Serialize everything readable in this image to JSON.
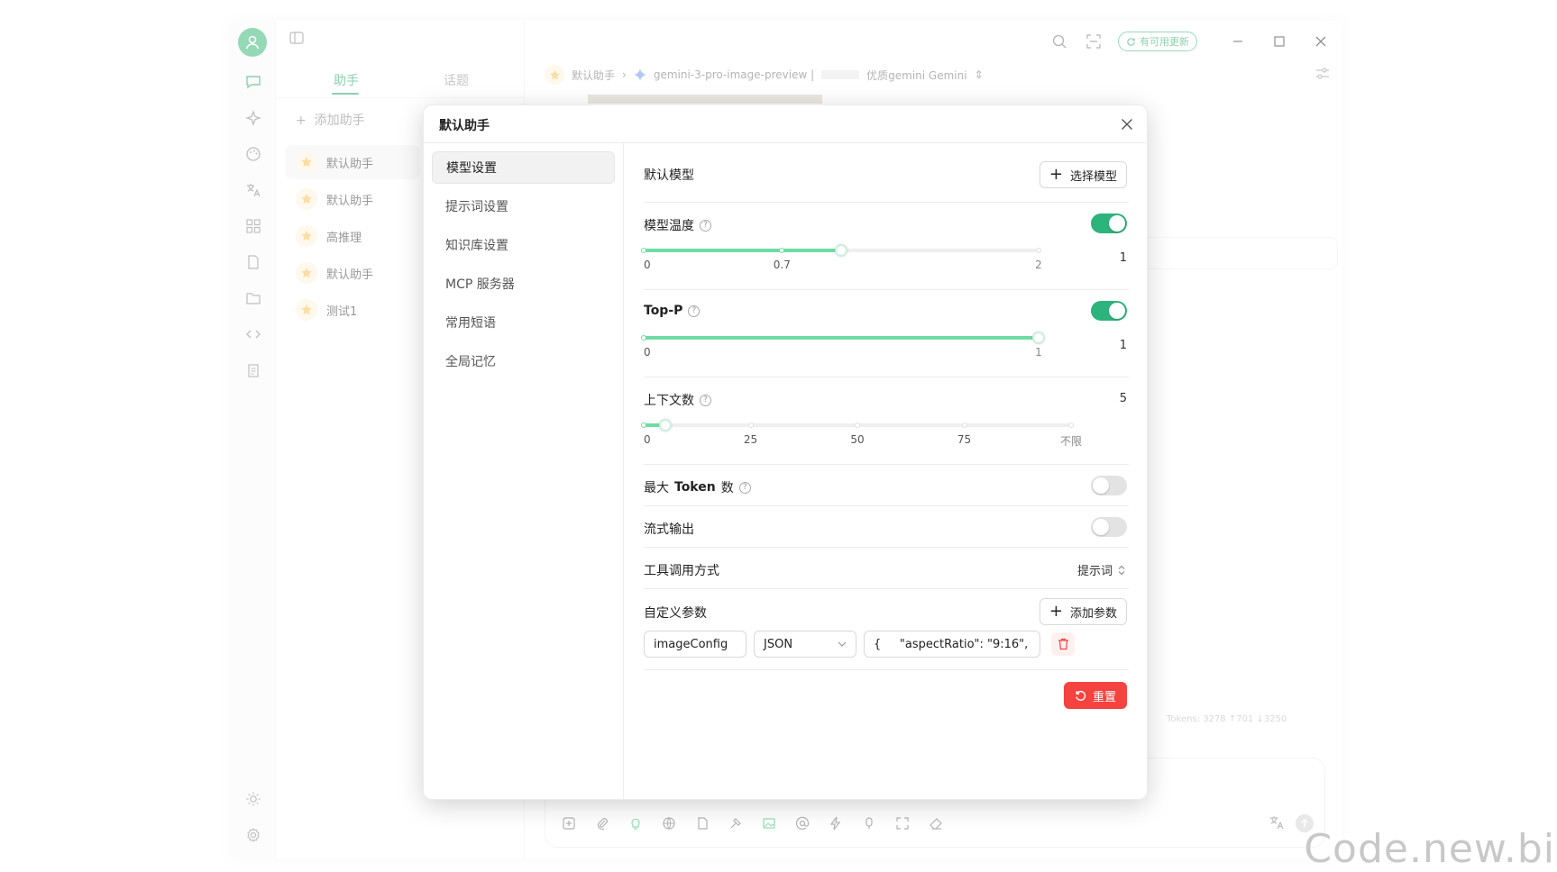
{
  "background": {
    "tabs": [
      "助手",
      "话题"
    ],
    "add_assistant": "添加助手",
    "assistants": [
      "默认助手",
      "默认助手",
      "高推理",
      "默认助手",
      "测试1"
    ],
    "breadcrumb": {
      "assistant": "默认助手",
      "model": "gemini-3-pro-image-preview |",
      "provider": "优质gemini Gemini"
    },
    "update_badge": "有可用更新",
    "token_info": "Tokens: 3278 ↑701 ↓3250"
  },
  "modal": {
    "title": "默认助手",
    "nav": [
      {
        "label": "模型设置",
        "active": true
      },
      {
        "label": "提示词设置",
        "active": false
      },
      {
        "label": "知识库设置",
        "active": false
      },
      {
        "label": "MCP 服务器",
        "active": false
      },
      {
        "label": "常用短语",
        "active": false
      },
      {
        "label": "全局记忆",
        "active": false
      }
    ],
    "default_model": {
      "label": "默认模型",
      "button": "选择模型"
    },
    "temperature": {
      "label": "模型温度",
      "enabled": true,
      "value": 1,
      "value_text": "1",
      "min": 0,
      "max": 2,
      "marks": [
        "0",
        "0.7",
        "2"
      ],
      "mark_values": [
        0,
        0.7,
        2
      ]
    },
    "top_p": {
      "label": "Top-P",
      "enabled": true,
      "value": 1,
      "value_text": "1",
      "min": 0,
      "max": 1,
      "marks": [
        "0",
        "1"
      ],
      "mark_values": [
        0,
        1
      ]
    },
    "context_count": {
      "label": "上下文数",
      "value": 5,
      "value_text": "5",
      "min": 0,
      "max": 100,
      "marks": [
        "0",
        "25",
        "50",
        "75",
        "不限"
      ],
      "mark_values": [
        0,
        25,
        50,
        75,
        100
      ]
    },
    "max_tokens": {
      "label_prefix": "最大",
      "label_bold": "Token",
      "label_suffix": "数",
      "enabled": false
    },
    "stream_output": {
      "label": "流式输出",
      "enabled": false
    },
    "tool_call_mode": {
      "label": "工具调用方式",
      "value": "提示词"
    },
    "custom_params": {
      "label": "自定义参数",
      "button": "添加参数",
      "items": [
        {
          "name": "imageConfig",
          "type": "JSON",
          "value": "{     \"aspectRatio\": \"9:16\",     \""
        }
      ]
    },
    "reset_button": "重置"
  },
  "colors": {
    "accent": "#2db37c",
    "slider_track": "#6fdca3",
    "danger": "#f5433f"
  },
  "watermark": "Code.new.bi"
}
